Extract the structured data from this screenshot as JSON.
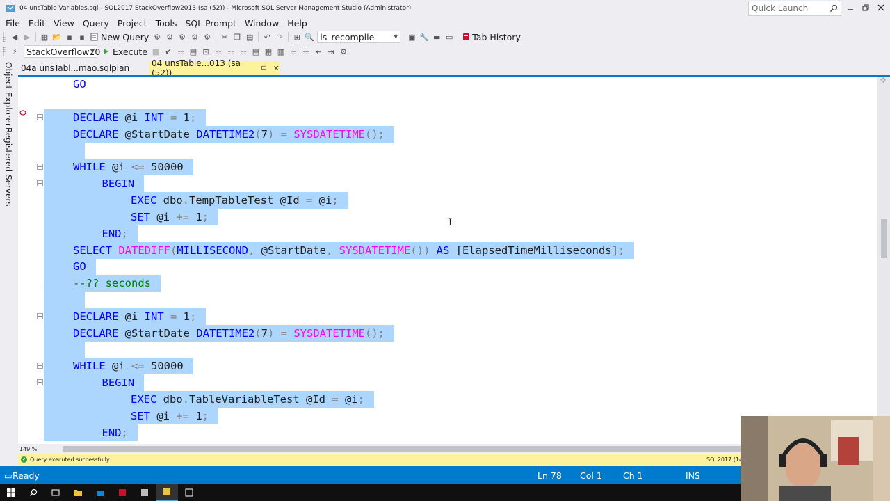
{
  "window": {
    "title": "04 unsTable Variables.sql - SQL2017.StackOverflow2013 (sa (52)) - Microsoft SQL Server Management Studio (Administrator)",
    "quick_launch_placeholder": "Quick Launch"
  },
  "menu": [
    "File",
    "Edit",
    "View",
    "Query",
    "Project",
    "Tools",
    "SQL Prompt",
    "Window",
    "Help"
  ],
  "toolbar1": {
    "new_query_label": "New Query",
    "search_combo_value": "is_recompile",
    "tab_history_label": "Tab History"
  },
  "toolbar2": {
    "database_combo_value": "StackOverflow20",
    "execute_label": "Execute"
  },
  "side_tabs": [
    "Object Explorer",
    "Registered Servers"
  ],
  "doc_tabs": [
    {
      "label": "04a unsTabl...mao.sqlplan",
      "active": false
    },
    {
      "label": "04 unsTable...013 (sa (52))",
      "active": true
    }
  ],
  "editor": {
    "lines": [
      {
        "tokens": [
          {
            "t": "GO",
            "c": "kw"
          }
        ],
        "indent": 1,
        "selected": false
      },
      {
        "tokens": [],
        "indent": 0,
        "selected": false
      },
      {
        "tokens": [
          {
            "t": "DECLARE ",
            "c": "kw"
          },
          {
            "t": "@i ",
            "c": "tx"
          },
          {
            "t": "INT ",
            "c": "kw"
          },
          {
            "t": "= ",
            "c": "op"
          },
          {
            "t": "1",
            "c": "tx"
          },
          {
            "t": ";",
            "c": "op"
          }
        ],
        "indent": 1,
        "selected": true
      },
      {
        "tokens": [
          {
            "t": "DECLARE ",
            "c": "kw"
          },
          {
            "t": "@StartDate ",
            "c": "tx"
          },
          {
            "t": "DATETIME2",
            "c": "kw"
          },
          {
            "t": "(",
            "c": "op"
          },
          {
            "t": "7",
            "c": "tx"
          },
          {
            "t": ") = ",
            "c": "op"
          },
          {
            "t": "SYSDATETIME",
            "c": "fn"
          },
          {
            "t": "();",
            "c": "op"
          }
        ],
        "indent": 1,
        "selected": true
      },
      {
        "tokens": [],
        "indent": 1,
        "selected": true
      },
      {
        "tokens": [
          {
            "t": "WHILE ",
            "c": "kw"
          },
          {
            "t": "@i ",
            "c": "tx"
          },
          {
            "t": "<= ",
            "c": "op"
          },
          {
            "t": "50000",
            "c": "tx"
          }
        ],
        "indent": 1,
        "selected": true
      },
      {
        "tokens": [
          {
            "t": "BEGIN",
            "c": "kw"
          }
        ],
        "indent": 2,
        "selected": true
      },
      {
        "tokens": [
          {
            "t": "EXEC ",
            "c": "kw"
          },
          {
            "t": "dbo",
            "c": "tx"
          },
          {
            "t": ".",
            "c": "op"
          },
          {
            "t": "TempTableTest ",
            "c": "tx"
          },
          {
            "t": "@Id ",
            "c": "tx"
          },
          {
            "t": "= ",
            "c": "op"
          },
          {
            "t": "@i",
            "c": "tx"
          },
          {
            "t": ";",
            "c": "op"
          }
        ],
        "indent": 3,
        "selected": true
      },
      {
        "tokens": [
          {
            "t": "SET ",
            "c": "kw"
          },
          {
            "t": "@i ",
            "c": "tx"
          },
          {
            "t": "+= ",
            "c": "op"
          },
          {
            "t": "1",
            "c": "tx"
          },
          {
            "t": ";",
            "c": "op"
          }
        ],
        "indent": 3,
        "selected": true
      },
      {
        "tokens": [
          {
            "t": "END",
            "c": "kw"
          },
          {
            "t": ";",
            "c": "op"
          }
        ],
        "indent": 2,
        "selected": true
      },
      {
        "tokens": [
          {
            "t": "SELECT ",
            "c": "kw"
          },
          {
            "t": "DATEDIFF",
            "c": "fn"
          },
          {
            "t": "(",
            "c": "op"
          },
          {
            "t": "MILLISECOND",
            "c": "kw"
          },
          {
            "t": ", ",
            "c": "op"
          },
          {
            "t": "@StartDate",
            "c": "tx"
          },
          {
            "t": ", ",
            "c": "op"
          },
          {
            "t": "SYSDATETIME",
            "c": "fn"
          },
          {
            "t": "()) ",
            "c": "op"
          },
          {
            "t": "AS ",
            "c": "kw"
          },
          {
            "t": "[ElapsedTimeMilliseconds]",
            "c": "tx"
          },
          {
            "t": ";",
            "c": "op"
          }
        ],
        "indent": 1,
        "selected": true
      },
      {
        "tokens": [
          {
            "t": "GO",
            "c": "kw"
          }
        ],
        "indent": 1,
        "selected": true
      },
      {
        "tokens": [
          {
            "t": "--?? seconds",
            "c": "cm"
          }
        ],
        "indent": 1,
        "selected": true
      },
      {
        "tokens": [],
        "indent": 1,
        "selected": true
      },
      {
        "tokens": [
          {
            "t": "DECLARE ",
            "c": "kw"
          },
          {
            "t": "@i ",
            "c": "tx"
          },
          {
            "t": "INT ",
            "c": "kw"
          },
          {
            "t": "= ",
            "c": "op"
          },
          {
            "t": "1",
            "c": "tx"
          },
          {
            "t": ";",
            "c": "op"
          }
        ],
        "indent": 1,
        "selected": true
      },
      {
        "tokens": [
          {
            "t": "DECLARE ",
            "c": "kw"
          },
          {
            "t": "@StartDate ",
            "c": "tx"
          },
          {
            "t": "DATETIME2",
            "c": "kw"
          },
          {
            "t": "(",
            "c": "op"
          },
          {
            "t": "7",
            "c": "tx"
          },
          {
            "t": ") = ",
            "c": "op"
          },
          {
            "t": "SYSDATETIME",
            "c": "fn"
          },
          {
            "t": "();",
            "c": "op"
          }
        ],
        "indent": 1,
        "selected": true
      },
      {
        "tokens": [],
        "indent": 1,
        "selected": true
      },
      {
        "tokens": [
          {
            "t": "WHILE ",
            "c": "kw"
          },
          {
            "t": "@i ",
            "c": "tx"
          },
          {
            "t": "<= ",
            "c": "op"
          },
          {
            "t": "50000",
            "c": "tx"
          }
        ],
        "indent": 1,
        "selected": true
      },
      {
        "tokens": [
          {
            "t": "BEGIN",
            "c": "kw"
          }
        ],
        "indent": 2,
        "selected": true
      },
      {
        "tokens": [
          {
            "t": "EXEC ",
            "c": "kw"
          },
          {
            "t": "dbo",
            "c": "tx"
          },
          {
            "t": ".",
            "c": "op"
          },
          {
            "t": "TableVariableTest ",
            "c": "tx"
          },
          {
            "t": "@Id ",
            "c": "tx"
          },
          {
            "t": "= ",
            "c": "op"
          },
          {
            "t": "@i",
            "c": "tx"
          },
          {
            "t": ";",
            "c": "op"
          }
        ],
        "indent": 3,
        "selected": true
      },
      {
        "tokens": [
          {
            "t": "SET ",
            "c": "kw"
          },
          {
            "t": "@i ",
            "c": "tx"
          },
          {
            "t": "+= ",
            "c": "op"
          },
          {
            "t": "1",
            "c": "tx"
          },
          {
            "t": ";",
            "c": "op"
          }
        ],
        "indent": 3,
        "selected": true
      },
      {
        "tokens": [
          {
            "t": "END",
            "c": "kw"
          },
          {
            "t": ";",
            "c": "op"
          }
        ],
        "indent": 2,
        "selected": true
      }
    ]
  },
  "zoom": "149 %",
  "query_status": {
    "message": "Query executed successfully.",
    "server": "SQL2017 (14.0"
  },
  "statusbar": {
    "state": "Ready",
    "line": "Ln 78",
    "col": "Col 1",
    "ch": "Ch 1",
    "mode": "INS"
  },
  "colors": {
    "accent": "#007acc",
    "selection": "#add6ff",
    "keyword": "#0000ff",
    "function": "#ff00ff",
    "comment": "#008000",
    "active_tab": "#fff29d"
  }
}
